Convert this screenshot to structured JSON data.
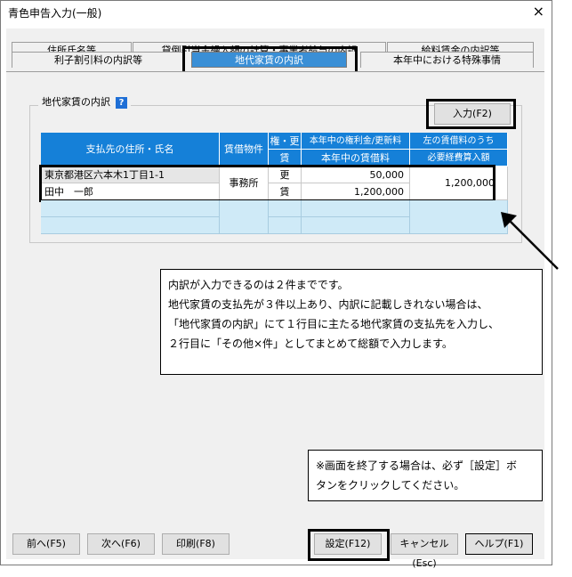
{
  "window": {
    "title": "青色申告入力(一般)",
    "close_glyph": "×"
  },
  "tabs": {
    "row1": [
      "住所氏名等",
      "貸倒引当金繰入額の計算・事業者給与の内訳",
      "給料賃金の内訳等"
    ],
    "row2": [
      "利子割引料の内訳等",
      "地代家賃の内訳",
      "本年中における特殊事情"
    ],
    "active": "地代家賃の内訳"
  },
  "group": {
    "label": "地代家賃の内訳",
    "help_glyph": "?"
  },
  "input_button": "入力(F2)",
  "table": {
    "headers": {
      "payee": "支払先の住所・氏名",
      "property": "賃借物件",
      "rights_top": "権・更",
      "rights_bottom": "賃",
      "amount_top": "本年中の権利金/更新料",
      "amount_bottom": "本年中の賃借料",
      "deductible_top": "左の賃借料のうち",
      "deductible_bottom": "必要経費算入額"
    },
    "rows": [
      {
        "address": "東京都港区六本木1丁目1-1",
        "name": "田中　一郎",
        "property": "事務所",
        "type_top": "更",
        "type_bottom": "賃",
        "amount_top": "50,000",
        "amount_bottom": "1,200,000",
        "deductible": "1,200,000"
      }
    ]
  },
  "callouts": {
    "note1": [
      "内訳が入力できるのは２件までです。",
      "地代家賃の支払先が３件以上あり、内訳に記載しきれない場合は、",
      "「地代家賃の内訳」にて１行目に主たる地代家賃の支払先を入力し、",
      "２行目に「その他×件」としてまとめて総額で入力します。"
    ],
    "note2": [
      "※画面を終了する場合は、必ず［設定］ボ",
      "タンをクリックしてください。"
    ]
  },
  "footer": {
    "prev": "前へ(F5)",
    "next": "次へ(F6)",
    "print": "印刷(F8)",
    "save": "設定(F12)",
    "cancel": "キャンセル(Esc)",
    "help": "ヘルプ(F1)"
  }
}
